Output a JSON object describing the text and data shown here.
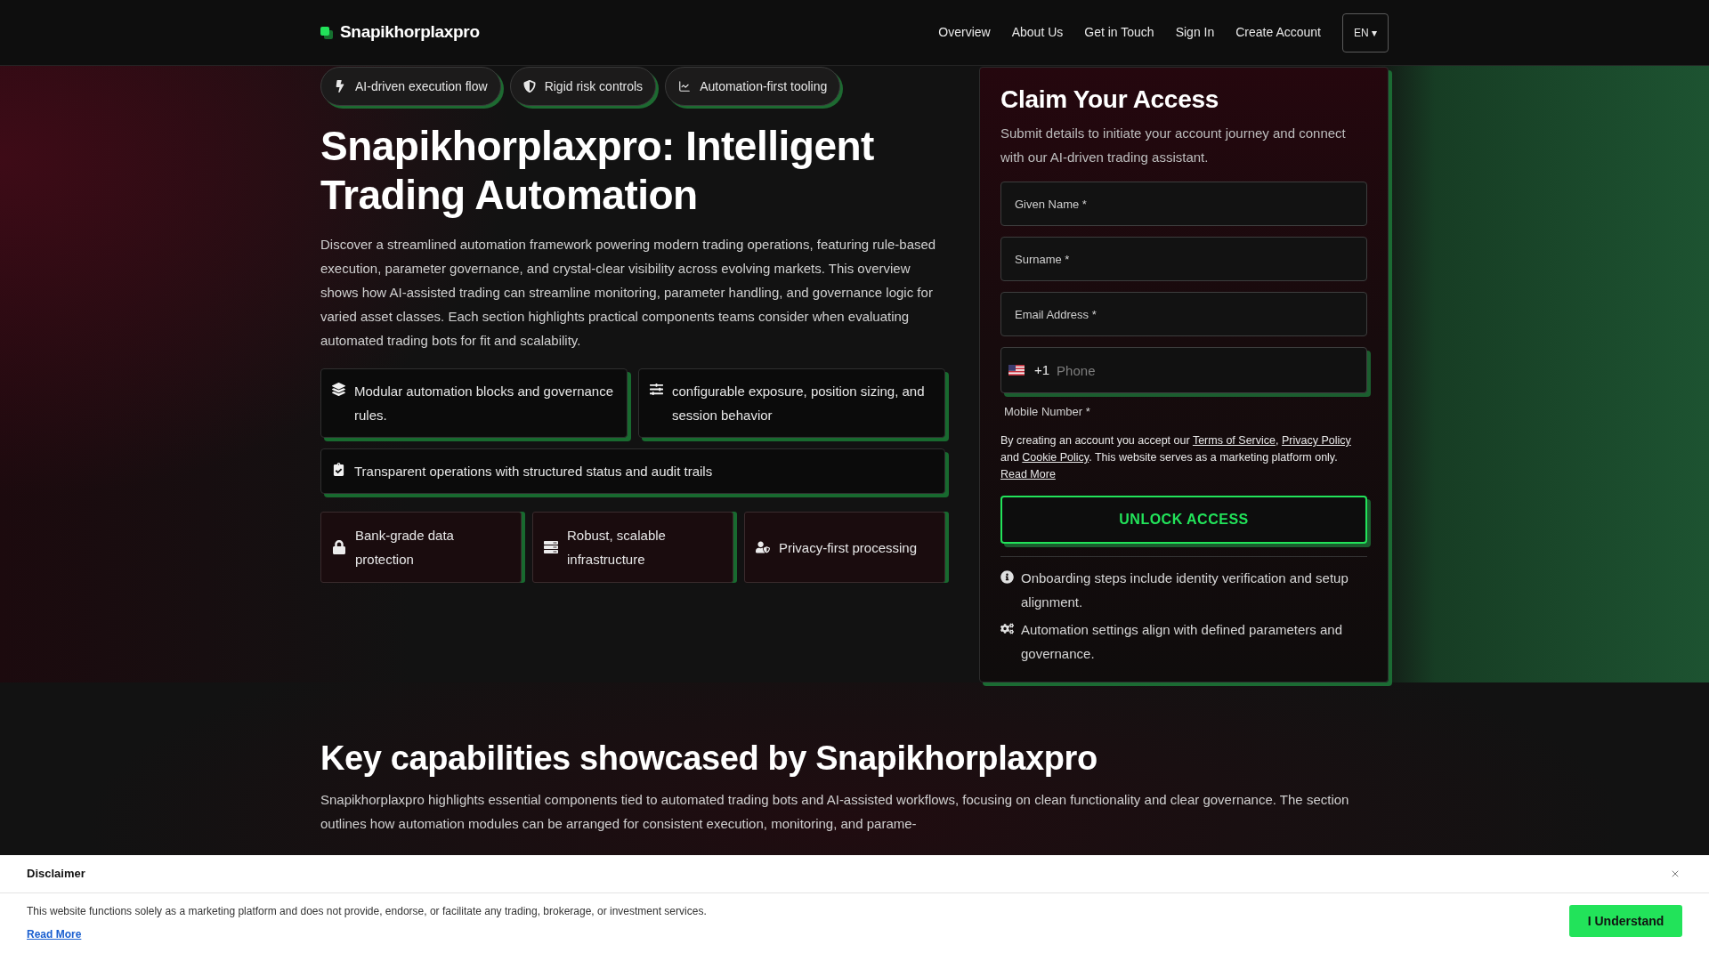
{
  "header": {
    "logo": "Snapikhorplaxpro",
    "nav": [
      "Overview",
      "About Us",
      "Get in Touch",
      "Sign In",
      "Create Account"
    ],
    "language": "EN ▾"
  },
  "hero": {
    "chips": [
      "AI-driven execution flow",
      "Rigid risk controls",
      "Automation-first tooling"
    ],
    "title": "Snapikhorplaxpro: Intelligent Trading Automation",
    "intro": "Discover a streamlined automation framework powering modern trading operations, featuring rule-based execution, parameter governance, and crystal-clear visibility across evolving markets. This overview shows how AI-assisted trading can streamline monitoring, parameter handling, and governance logic for varied asset classes. Each section highlights practical components teams consider when evaluating automated trading bots for fit and scalability.",
    "highlights": [
      "Modular automation blocks and governance rules.",
      "configurable exposure, position sizing, and session behavior",
      "Transparent operations with structured status and audit trails"
    ],
    "assurances": [
      "Bank-grade data protection",
      "Robust, scalable infrastructure",
      "Privacy-first processing"
    ]
  },
  "signup_form": {
    "title": "Claim Your Access",
    "subtitle": "Submit details to initiate your account journey and connect with our AI-driven trading assistant.",
    "fields": [
      {
        "placeholder": "Given Name *"
      },
      {
        "placeholder": "Surname *"
      },
      {
        "placeholder": "Email Address *"
      }
    ],
    "phone": {
      "dial_code": "+1",
      "placeholder": "Phone",
      "label": "Mobile Number *"
    },
    "consent": [
      {
        "kind": "text",
        "text": "By creating an account you accept our "
      },
      {
        "kind": "link",
        "text": "Terms of Service"
      },
      {
        "kind": "text",
        "text": ", "
      },
      {
        "kind": "link",
        "text": "Privacy Policy"
      },
      {
        "kind": "text",
        "text": " and "
      },
      {
        "kind": "link",
        "text": "Cookie Policy"
      },
      {
        "kind": "text",
        "text": ". This website serves as a marketing platform only. "
      },
      {
        "kind": "link",
        "text": "Read More"
      }
    ],
    "submit": "UNLOCK ACCESS",
    "notes": [
      "Onboarding steps include identity verification and setup alignment.",
      "Automation settings align with defined parameters and governance."
    ]
  },
  "capabilities": {
    "title": "Key capabilities showcased by Snapikhorplaxpro",
    "text": "Snapikhorplaxpro highlights essential components tied to automated trading bots and AI-assisted workflows, focusing on clean functionality and clear governance. The section outlines how automation modules can be arranged for consistent execution, monitoring, and parame-"
  },
  "disclaimer": {
    "title": "Disclaimer",
    "text": "This website functions solely as a marketing platform and does not provide, endorse, or facilitate any trading, brokerage, or investment services.",
    "link": "Read More",
    "button": "I Understand"
  }
}
